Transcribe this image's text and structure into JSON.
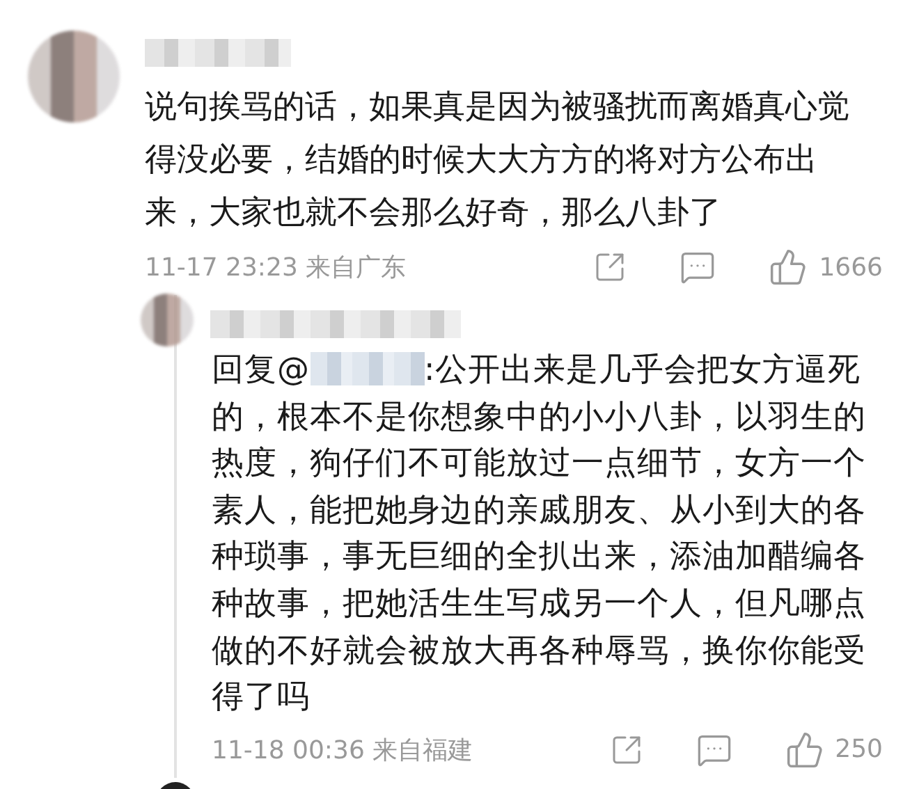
{
  "comments": [
    {
      "text": "说句挨骂的话，如果真是因为被骚扰而离婚真心觉得没必要，结婚的时候大大方方的将对方公布出来，大家也就不会那么好奇，那么八卦了",
      "time": "11-17 23:23",
      "location": "来自广东",
      "likes": "1666",
      "replies": [
        {
          "prefix": "回复@",
          "text": ":公开出来是几乎会把女方逼死的，根本不是你想象中的小小八卦，以羽生的热度，狗仔们不可能放过一点细节，女方一个素人，能把她身边的亲戚朋友、从小到大的各种琐事，事无巨细的全扒出来，添油加醋编各种故事，把她活生生写成另一个人，但凡哪点做的不好就会被放大再各种辱骂，换你你能受得了吗",
          "time": "11-18 00:36",
          "location": "来自福建",
          "likes": "250"
        }
      ]
    }
  ]
}
